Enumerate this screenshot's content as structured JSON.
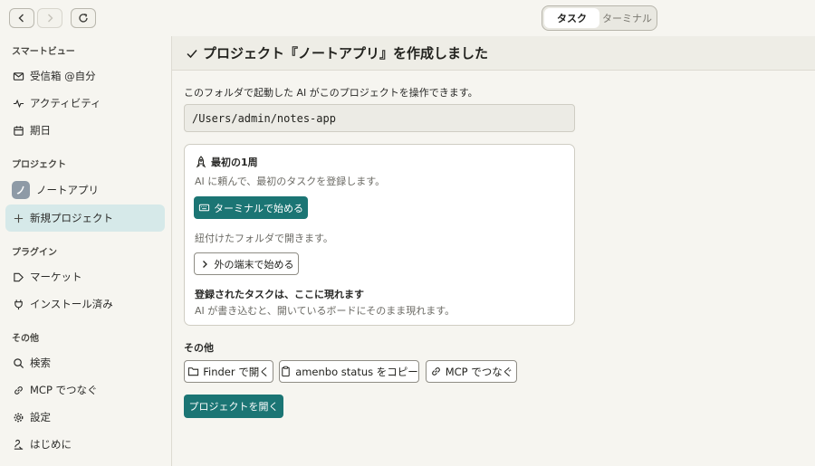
{
  "nav": {
    "back_icon": "chevron-left-icon",
    "forward_icon": "chevron-right-icon",
    "reload_icon": "reload-icon"
  },
  "mode_tabs": [
    {
      "label": "タスク",
      "active": true
    },
    {
      "label": "ターミナル",
      "active": false
    }
  ],
  "sidebar": {
    "smart_view_label": "スマートビュー",
    "smart_items": [
      {
        "label": "受信箱 @自分",
        "icon": "mail-icon"
      },
      {
        "label": "アクティビティ",
        "icon": "activity-icon"
      },
      {
        "label": "期日",
        "icon": "calendar-icon"
      }
    ],
    "project_label": "プロジェクト",
    "project_badge": "ノ",
    "project_name": "ノートアプリ",
    "new_project": "新規プロジェクト",
    "plugin_label": "プラグイン",
    "plugin_items": [
      {
        "label": "マーケット",
        "icon": "tag-icon"
      },
      {
        "label": "インストール済み",
        "icon": "plug-icon"
      }
    ],
    "other_label": "その他",
    "other_items": [
      {
        "label": "検索",
        "icon": "search-icon"
      },
      {
        "label": "MCP でつなぐ",
        "icon": "link-icon"
      },
      {
        "label": "設定",
        "icon": "gear-icon"
      },
      {
        "label": "はじめに",
        "icon": "sign-icon"
      }
    ]
  },
  "main": {
    "title": "プロジェクト『ノートアプリ』を作成しました",
    "description": "このフォルダで起動した AI がこのプロジェクトを操作できます。",
    "path": "/Users/admin/notes-app",
    "card": {
      "title": "最初の1周",
      "subtitle": "AI に頼んで、最初のタスクを登録します。",
      "terminal_button": "ターミナルで始める",
      "linked_note": "紐付けたフォルダで開きます。",
      "external_button": "外の端末で始める",
      "bold_text": "登録されたタスクは、ここに現れます",
      "bold_sub": "AI が書き込むと、開いているボードにそのまま現れます。"
    },
    "other_label": "その他",
    "finder_button": "Finder で開く",
    "copy_button": "amenbo status をコピー",
    "mcp_button": "MCP でつなぐ",
    "open_project_button": "プロジェクトを開く"
  },
  "colors": {
    "accent": "#1b7574",
    "active_bg": "#d6e9e9"
  }
}
